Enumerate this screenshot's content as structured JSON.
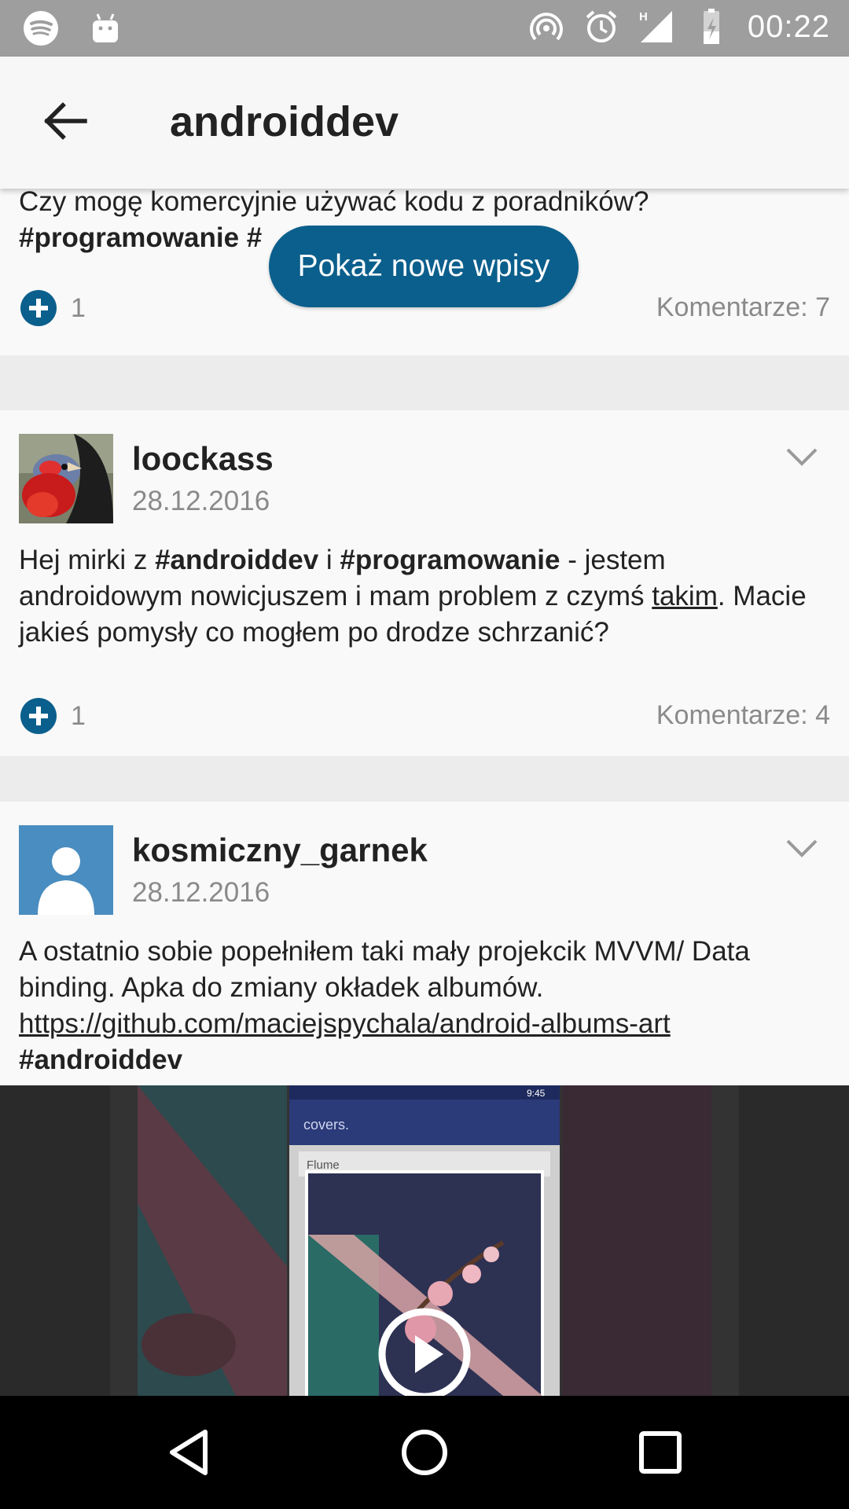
{
  "status_bar": {
    "time": "00:22",
    "left_icons": [
      "spotify-icon",
      "android-icon"
    ],
    "right_icons": [
      "hotspot-icon",
      "alarm-icon",
      "signal-icon",
      "battery-icon"
    ],
    "network_type": "H"
  },
  "app_bar": {
    "title": "androiddev"
  },
  "new_posts_button": "Pokaż nowe wpisy",
  "posts": [
    {
      "text_plain": "Czy mogę komercyjnie używać kodu z poradników?",
      "tags": "#programowanie #",
      "votes": "1",
      "comments": "Komentarze: 7"
    },
    {
      "author": "loockass",
      "date": "28.12.2016",
      "text": {
        "p1": "Hej mirki z ",
        "tag1": "#androiddev",
        "p2": " i ",
        "tag2": "#programowanie",
        "p3": " - jestem androidowym nowicjuszem i mam problem z czymś ",
        "link": "takim",
        "p4": ". Macie jakieś pomysły co mogłem po drodze schrzanić?"
      },
      "votes": "1",
      "comments": "Komentarze: 4"
    },
    {
      "author": "kosmiczny_garnek",
      "date": "28.12.2016",
      "text": {
        "p1": "A ostatnio sobie popełniłem taki mały projekcik MVVM/ Data binding. Apka do zmiany okładek albumów.",
        "link": "https://github.com/maciejspychala/android-albums-art",
        "tag": "#androiddev"
      },
      "media": {
        "app_title": "covers.",
        "search_text": "Flume",
        "status_time": "9:45"
      }
    }
  ],
  "nav_bar": {
    "buttons": [
      "back-nav-icon",
      "home-nav-icon",
      "recents-nav-icon"
    ]
  },
  "colors": {
    "accent": "#0b5f8c",
    "status_bar": "#9e9e9e",
    "background": "#ececec"
  }
}
